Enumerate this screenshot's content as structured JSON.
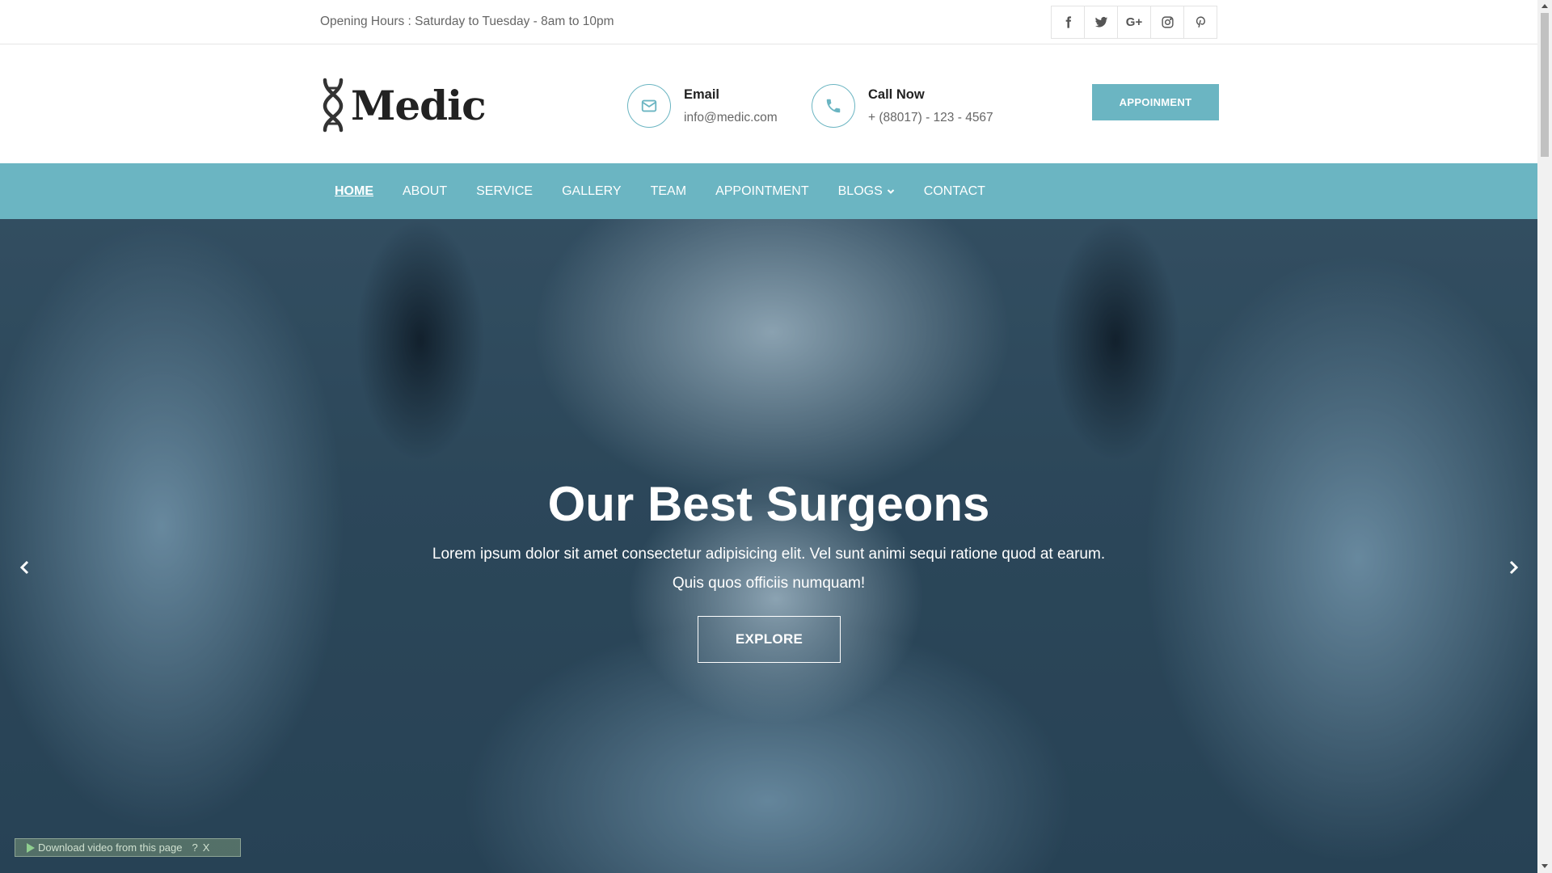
{
  "topbar": {
    "hours": "Opening Hours : Saturday to Tuesday - 8am to 10pm",
    "social": [
      "facebook-icon",
      "twitter-icon",
      "google-plus-icon",
      "instagram-icon",
      "pinterest-icon"
    ],
    "gplus_text": "G+"
  },
  "header": {
    "logo_text": "Medic",
    "email_label": "Email",
    "email_value": "info@medic.com",
    "call_label": "Call Now",
    "call_value": "+ (88017) - 123 - 4567",
    "appointment_button": "APPOINMENT"
  },
  "nav": {
    "items": [
      {
        "label": "HOME",
        "active": true
      },
      {
        "label": "ABOUT"
      },
      {
        "label": "SERVICE"
      },
      {
        "label": "GALLERY"
      },
      {
        "label": "TEAM"
      },
      {
        "label": "APPOINTMENT"
      },
      {
        "label": "BLOGS",
        "dropdown": true
      },
      {
        "label": "CONTACT"
      }
    ]
  },
  "hero": {
    "title": "Our Best Surgeons",
    "subtitle_line1": "Lorem ipsum dolor sit amet consectetur adipisicing elit. Vel sunt animi sequi ratione quod at earum.",
    "subtitle_line2": "Quis quos officiis numquam!",
    "cta": "EXPLORE"
  },
  "extension": {
    "download_label": "Download video from this page",
    "help": "?",
    "close": "X"
  },
  "colors": {
    "accent": "#6bb5c2",
    "dark_text": "#222222"
  }
}
